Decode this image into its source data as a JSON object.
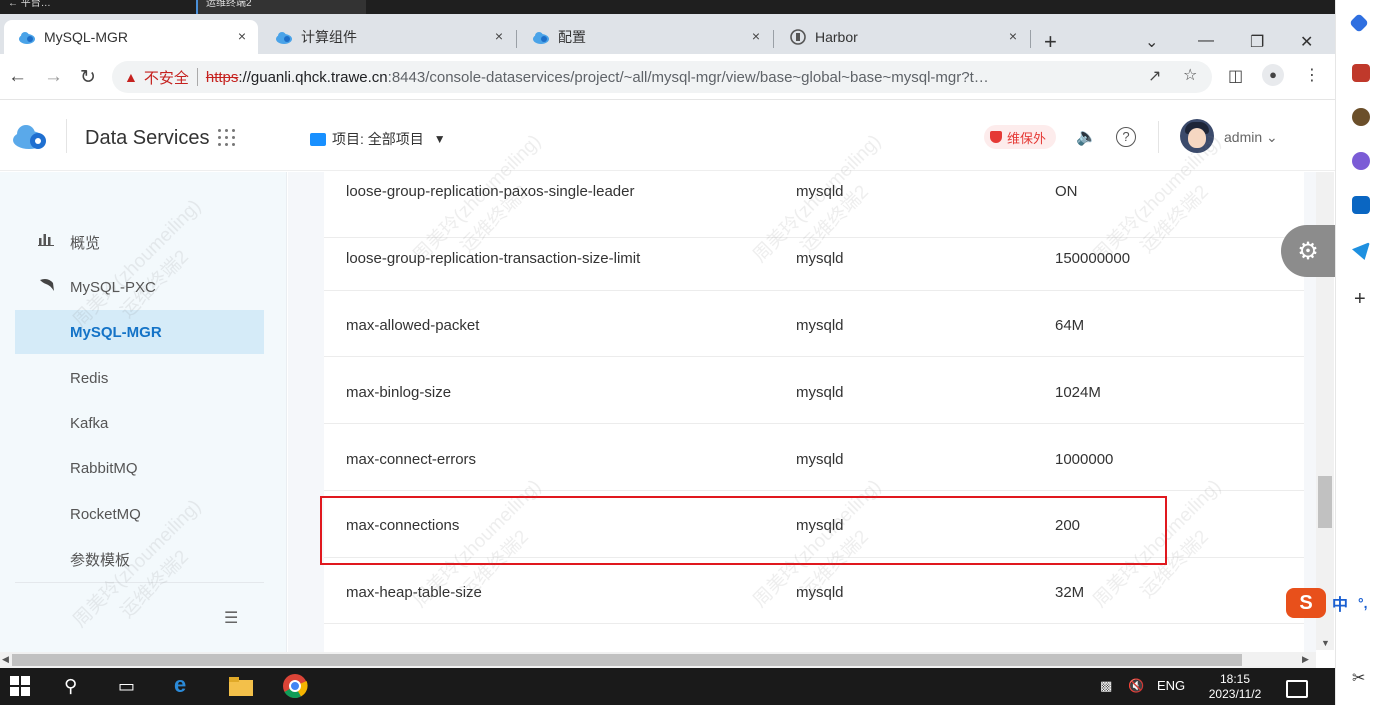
{
  "rdp_bar": {
    "item1": "← 平台…",
    "item2": "运维终端2"
  },
  "browser": {
    "tabs": [
      {
        "label": "MySQL-MGR",
        "close": "×",
        "icon": "cloud-icon"
      },
      {
        "label": "计算组件",
        "close": "×",
        "icon": "cloud-icon"
      },
      {
        "label": "配置",
        "close": "×",
        "icon": "cloud-icon"
      },
      {
        "label": "Harbor",
        "close": "×",
        "icon": "harbor-icon"
      }
    ],
    "new_tab": "+",
    "address": {
      "security_label": "不安全",
      "scheme": "https",
      "host": "://guanli.qhck.trawe.cn",
      "path": ":8443/console-dataservices/project/~all/mysql-mgr/view/base~global~base~mysql-mgr?t…"
    }
  },
  "app_header": {
    "brand": "Data Services",
    "project_selector": "项目: 全部项目",
    "maintenance_badge": "维保外",
    "user": "admin"
  },
  "sidebar": {
    "items": [
      {
        "label": "概览",
        "icon": "bar-chart-icon"
      },
      {
        "label": "MySQL-PXC",
        "icon": "dolphin-icon"
      },
      {
        "label": "MySQL-MGR",
        "active": true
      },
      {
        "label": "Redis"
      },
      {
        "label": "Kafka"
      },
      {
        "label": "RabbitMQ"
      },
      {
        "label": "RocketMQ"
      },
      {
        "label": "参数模板"
      }
    ]
  },
  "params_table": {
    "rows": [
      {
        "name": "loose-group-replication-paxos-single-leader",
        "section": "mysqld",
        "value": "ON"
      },
      {
        "name": "loose-group-replication-transaction-size-limit",
        "section": "mysqld",
        "value": "150000000"
      },
      {
        "name": "max-allowed-packet",
        "section": "mysqld",
        "value": "64M"
      },
      {
        "name": "max-binlog-size",
        "section": "mysqld",
        "value": "1024M"
      },
      {
        "name": "max-connect-errors",
        "section": "mysqld",
        "value": "1000000"
      },
      {
        "name": "max-connections",
        "section": "mysqld",
        "value": "200",
        "highlighted": true
      },
      {
        "name": "max-heap-table-size",
        "section": "mysqld",
        "value": "32M"
      }
    ]
  },
  "watermark": {
    "line1": "周美玲(zhoumeiling)",
    "line2": "运维终端2"
  },
  "ime": {
    "logo": "S",
    "lang": "中",
    "punct": "°,"
  },
  "taskbar": {
    "lang": "ENG",
    "time": "18:15",
    "date": "2023/11/2"
  },
  "colors": {
    "accent": "#1473c7",
    "highlight": "#e0181e",
    "sidebar_bg": "#f3f9fc",
    "active_bg": "#d5ebf8"
  }
}
